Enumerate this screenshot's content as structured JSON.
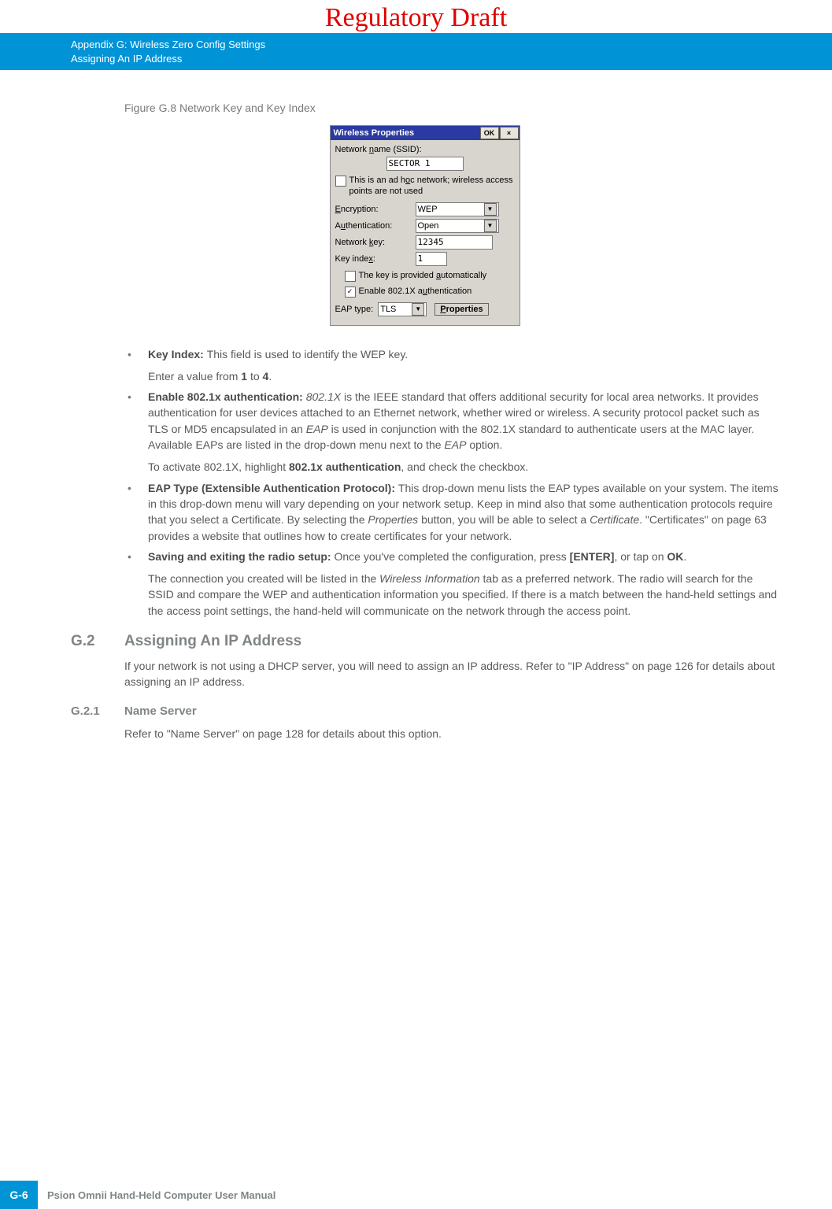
{
  "header": {
    "regulatory": "Regulatory Draft",
    "appendix_line1": "Appendix G: Wireless Zero Config Settings",
    "appendix_line2": "Assigning An IP Address"
  },
  "figure": {
    "caption": "Figure G.8   Network Key and Key Index",
    "dialog": {
      "title": "Wireless Properties",
      "ok": "OK",
      "close": "×",
      "ssid_label_pre": "Network ",
      "ssid_label_u": "n",
      "ssid_label_post": "ame (SSID):",
      "ssid_value": "SECTOR 1",
      "adhoc_pre": "This is an ad h",
      "adhoc_u": "o",
      "adhoc_post": "c network; wireless access points are not used",
      "enc_label_u": "E",
      "enc_label_post": "ncryption:",
      "enc_value": "WEP",
      "auth_label_pre": "A",
      "auth_label_u": "u",
      "auth_label_post": "thentication:",
      "auth_value": "Open",
      "nkey_label_pre": "Network ",
      "nkey_label_u": "k",
      "nkey_label_post": "ey:",
      "nkey_value": "12345",
      "kidx_label_pre": "Key inde",
      "kidx_label_u": "x",
      "kidx_label_post": ":",
      "kidx_value": "1",
      "auto_pre": "The key is provided ",
      "auto_u": "a",
      "auto_post": "utomatically",
      "e8021x_pre": "Enable 802.1X a",
      "e8021x_u": "u",
      "e8021x_post": "thentication",
      "eap_label": "EAP type:",
      "eap_value": "TLS",
      "properties_u": "P",
      "properties_post": "roperties"
    }
  },
  "bullets": {
    "b1_lead": "Key Index: ",
    "b1_text": "This field is used to identify the WEP key.",
    "b1_follow_pre": "Enter a value from ",
    "b1_follow_1": "1",
    "b1_follow_mid": " to ",
    "b1_follow_4": "4",
    "b1_follow_post": ".",
    "b2_lead": "Enable 802.1x authentication: ",
    "b2_i1": "802.1X",
    "b2_text1": " is the IEEE standard that offers additional security for local area networks. It provides authentication for user devices attached to an Ethernet network, whether wired or wireless. A security protocol packet such as TLS or MD5 encapsulated in an ",
    "b2_i2": "EAP",
    "b2_text2": " is used in conjunction with the 802.1X standard to authenticate users at the MAC layer. Available EAPs are listed in the drop-down menu next to the ",
    "b2_i3": "EAP",
    "b2_text3": " option.",
    "b2_follow_pre": "To activate 802.1X, highlight ",
    "b2_follow_bold": "802.1x authentication",
    "b2_follow_post": ", and check the checkbox.",
    "b3_lead": "EAP Type (Extensible Authentication Protocol): ",
    "b3_text1": "This drop-down menu lists the EAP types available on your system. The items in this drop-down menu will vary depending on your network setup. Keep in mind also that some authentication protocols require that you select a Certificate. By selecting the ",
    "b3_i1": "Properties",
    "b3_text2": " button, you will be able to select a ",
    "b3_i2": "Certificate",
    "b3_text3": ". \"Certificates\" on page 63 provides a website that outlines how to create certificates for your network.",
    "b4_lead": "Saving and exiting the radio setup: ",
    "b4_text1": "Once you've completed the configuration, press ",
    "b4_bold1": "[ENTER]",
    "b4_text2": ", or tap on ",
    "b4_bold2": "OK",
    "b4_text3": ".",
    "b4_follow_pre": "The connection you created will be listed in the ",
    "b4_follow_i": "Wireless Information",
    "b4_follow_post": " tab as a preferred network. The radio will search for the SSID and compare the WEP and authentication information you specified. If there is a match between the hand-held settings and the access point settings, the hand-held will communicate on the network through the access point."
  },
  "sections": {
    "g2_num": "G.2",
    "g2_title": "Assigning An IP Address",
    "g2_body": "If your network is not using a DHCP server, you will need to assign an IP address. Refer to \"IP Address\" on page 126 for details about assigning an IP address.",
    "g21_num": "G.2.1",
    "g21_title": "Name Server",
    "g21_body": "Refer to \"Name Server\" on page 128 for details about this option."
  },
  "footer": {
    "pagenum": "G-6",
    "manual": "Psion Omnii Hand-Held Computer User Manual"
  }
}
